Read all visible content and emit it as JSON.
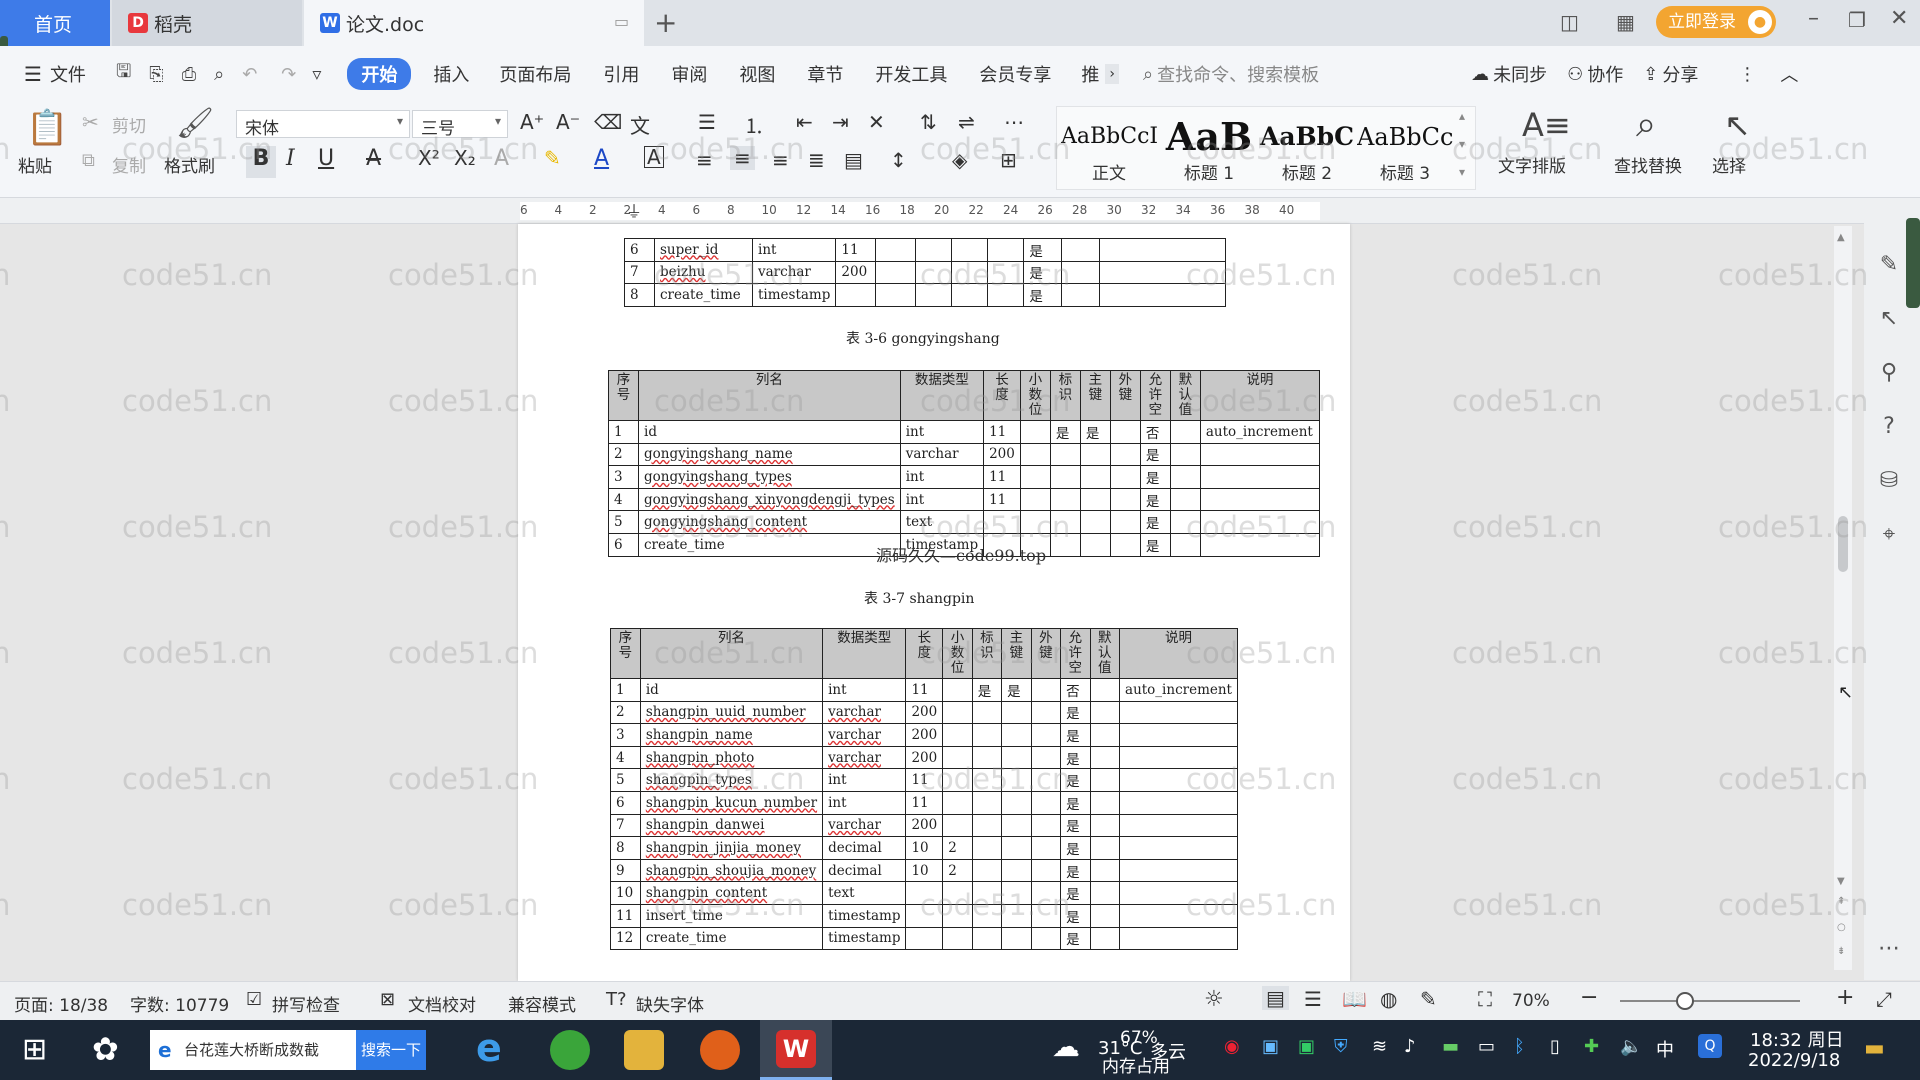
{
  "tabs": {
    "home": "首页",
    "daoke": "稻壳",
    "doc": "论文.doc",
    "add": "+"
  },
  "titlebar": {
    "login": "立即登录"
  },
  "menu": {
    "file": "文件",
    "items": [
      "开始",
      "插入",
      "页面布局",
      "引用",
      "审阅",
      "视图",
      "章节",
      "开发工具",
      "会员专享",
      "推"
    ],
    "search": "查找命令、搜索模板",
    "sync": "未同步",
    "collab": "协作",
    "share": "分享"
  },
  "ribbon": {
    "paste": "粘贴",
    "cut": "剪切",
    "copy": "复制",
    "format_painter": "格式刷",
    "font_name": "宋体",
    "font_size": "三号",
    "styles": [
      {
        "sample": "AaBbCcI",
        "label": "正文"
      },
      {
        "sample": "AaB",
        "label": "标题 1"
      },
      {
        "sample": "AaBbC",
        "label": "标题 2"
      },
      {
        "sample": "AaBbCc",
        "label": "标题 3"
      }
    ],
    "text_layout": "文字排版",
    "find_replace": "查找替换",
    "select": "选择"
  },
  "ruler_ticks": [
    "6",
    "4",
    "2",
    "2",
    "4",
    "6",
    "8",
    "10",
    "12",
    "14",
    "16",
    "18",
    "20",
    "22",
    "24",
    "26",
    "28",
    "30",
    "32",
    "34",
    "36",
    "38",
    "40"
  ],
  "document": {
    "table_top_rows": [
      [
        "6",
        "super_id",
        "int",
        "11",
        "",
        "",
        "",
        "",
        "是",
        "",
        ""
      ],
      [
        "7",
        "beizhu",
        "varchar",
        "200",
        "",
        "",
        "",
        "",
        "是",
        "",
        ""
      ],
      [
        "8",
        "create_time",
        "timestamp",
        "",
        "",
        "",
        "",
        "",
        "是",
        "",
        ""
      ]
    ],
    "caption_36": "表 3-6  gongyingshang",
    "headers": [
      "序号",
      "列名",
      "数据类型",
      "长度",
      "小数位",
      "标识",
      "主键",
      "外键",
      "允许空",
      "默认值",
      "说明"
    ],
    "table_36_rows": [
      [
        "1",
        "id",
        "int",
        "11",
        "",
        "是",
        "是",
        "",
        "否",
        "",
        "auto_increment"
      ],
      [
        "2",
        "gongyingshang_name",
        "varchar",
        "200",
        "",
        "",
        "",
        "",
        "是",
        "",
        ""
      ],
      [
        "3",
        "gongyingshang_types",
        "int",
        "11",
        "",
        "",
        "",
        "",
        "是",
        "",
        ""
      ],
      [
        "4",
        "gongyingshang_xinyongdengji_types",
        "int",
        "11",
        "",
        "",
        "",
        "",
        "是",
        "",
        ""
      ],
      [
        "5",
        "gongyingshang_content",
        "text",
        "",
        "",
        "",
        "",
        "",
        "是",
        "",
        ""
      ],
      [
        "6",
        "create_time",
        "timestamp",
        "",
        "",
        "",
        "",
        "",
        "是",
        "",
        ""
      ]
    ],
    "overlay_text": "源码久久—code99.top",
    "caption_37": "表 3-7  shangpin",
    "table_37_rows": [
      [
        "1",
        "id",
        "int",
        "11",
        "",
        "是",
        "是",
        "",
        "否",
        "",
        "auto_increment"
      ],
      [
        "2",
        "shangpin_uuid_number",
        "varchar",
        "200",
        "",
        "",
        "",
        "",
        "是",
        "",
        ""
      ],
      [
        "3",
        "shangpin_name",
        "varchar",
        "200",
        "",
        "",
        "",
        "",
        "是",
        "",
        ""
      ],
      [
        "4",
        "shangpin_photo",
        "varchar",
        "200",
        "",
        "",
        "",
        "",
        "是",
        "",
        ""
      ],
      [
        "5",
        "shangpin_types",
        "int",
        "11",
        "",
        "",
        "",
        "",
        "是",
        "",
        ""
      ],
      [
        "6",
        "shangpin_kucun_number",
        "int",
        "11",
        "",
        "",
        "",
        "",
        "是",
        "",
        ""
      ],
      [
        "7",
        "shangpin_danwei",
        "varchar",
        "200",
        "",
        "",
        "",
        "",
        "是",
        "",
        ""
      ],
      [
        "8",
        "shangpin_jinjia_money",
        "decimal",
        "10",
        "2",
        "",
        "",
        "",
        "是",
        "",
        ""
      ],
      [
        "9",
        "shangpin_shoujia_money",
        "decimal",
        "10",
        "2",
        "",
        "",
        "",
        "是",
        "",
        ""
      ],
      [
        "10",
        "shangpin_content",
        "text",
        "",
        "",
        "",
        "",
        "",
        "是",
        "",
        ""
      ],
      [
        "11",
        "insert_time",
        "timestamp",
        "",
        "",
        "",
        "",
        "",
        "是",
        "",
        ""
      ],
      [
        "12",
        "create_time",
        "timestamp",
        "",
        "",
        "",
        "",
        "",
        "是",
        "",
        ""
      ]
    ]
  },
  "watermark": "code51.cn",
  "status": {
    "page": "页面: 18/38",
    "words": "字数: 10779",
    "spell": "拼写检查",
    "proof": "文档校对",
    "compat": "兼容模式",
    "missing_font": "缺失字体",
    "zoom": "70%"
  },
  "taskbar": {
    "search_text": "台花莲大桥断成数截",
    "search_btn": "搜索一下",
    "weather_temp": "31°C",
    "weather_desc": "多云",
    "mem": "67%",
    "mem_label": "内存占用",
    "time": "18:32 周日",
    "date": "2022/9/18",
    "ime": "中"
  }
}
